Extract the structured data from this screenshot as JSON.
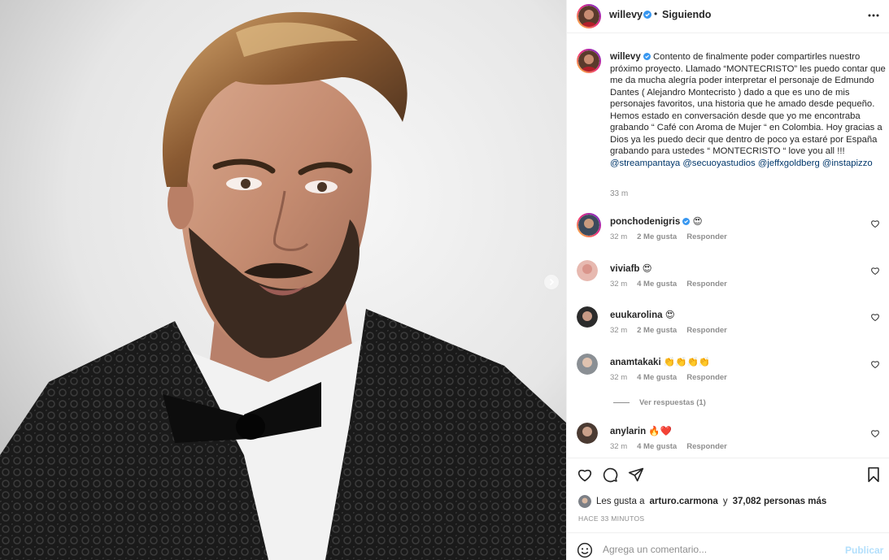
{
  "post": {
    "username": "willevy",
    "follow_status": "Siguiendo",
    "verified_icon": "verified-badge-icon",
    "accent": "#0095f6"
  },
  "caption": {
    "username": "willevy",
    "body": "Contento de finalmente poder compartirles nuestro próximo proyecto. Llamado “MONTECRISTO” les puedo contar que me da mucha alegría poder interpretar el personaje de Edmundo Dantes ( Alejandro Montecristo ) dado a que es uno de mis personajes favoritos, una historia que he amado desde pequeño. Hemos estado en conversación desde que yo me encontraba grabando “ Café con Aroma de Mujer “ en Colombia. Hoy gracias a Dios ya les puedo decir que dentro de poco ya estaré por España grabando para ustedes “ MONTECRISTO “ love you all !!! ",
    "mentions": [
      "@streampantaya",
      "@secuoyastudios",
      "@jeffxgoldberg",
      "@instapizzo"
    ],
    "time": "33 m"
  },
  "comments": [
    {
      "username": "ponchodenigris",
      "text": "😍",
      "time": "32 m",
      "likes": "2 Me gusta",
      "reply": "Responder"
    },
    {
      "username": "viviafb",
      "text": "😍",
      "time": "32 m",
      "likes": "4 Me gusta",
      "reply": "Responder"
    },
    {
      "username": "euukarolina",
      "text": "😍",
      "time": "32 m",
      "likes": "2 Me gusta",
      "reply": "Responder"
    },
    {
      "username": "anamtakaki",
      "text": "👏👏👏👏",
      "time": "32 m",
      "likes": "4 Me gusta",
      "reply": "Responder"
    },
    {
      "username": "anylarin",
      "text": "🔥❤️",
      "time": "32 m",
      "likes": "4 Me gusta",
      "reply": "Responder"
    }
  ],
  "view_replies": "Ver respuestas (1)",
  "likes": {
    "prefix": "Les gusta a",
    "user": "arturo.carmona",
    "connector": "y",
    "others": "37,082 personas más"
  },
  "posted_ago": "HACE 33 MINUTOS",
  "add_comment": {
    "placeholder": "Agrega un comentario...",
    "publish_label": "Publicar"
  }
}
